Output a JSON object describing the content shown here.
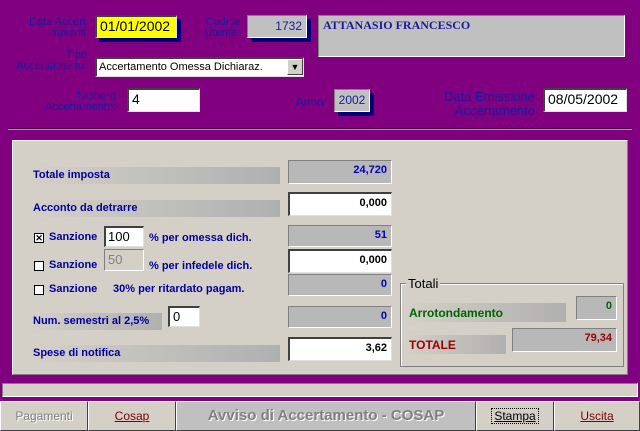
{
  "header": {
    "data_accert_label": "Data Accert impianti",
    "data_accert_value": "01/01/2002",
    "codice_utente_label": "Codice Utente:",
    "codice_utente_value": "1732",
    "nome_utente": "ATTANASIO FRANCESCO",
    "tipo_label": "Tipo Accertamento:",
    "tipo_value": "Accertamento Omessa Dichiaraz.",
    "numero_label": "Numero Accertamento:",
    "numero_value": "4",
    "anno_label": "Anno:",
    "anno_value": "2002",
    "data_emissione_label": "Data Emissione Accertamento",
    "data_emissione_value": "08/05/2002"
  },
  "form": {
    "totale_imposta_label": "Totale imposta",
    "totale_imposta_value": "24,720",
    "acconto_label": "Acconto da detrarre",
    "acconto_value": "0,000",
    "sanzione1_label": "Sanzione",
    "sanzione1_checked": true,
    "sanzione1_pct": "100",
    "sanzione1_desc": "% per omessa dich.",
    "sanzione1_value": "51",
    "sanzione2_label": "Sanzione",
    "sanzione2_checked": false,
    "sanzione2_pct": "50",
    "sanzione2_desc": "% per infedele dich.",
    "sanzione2_value": "0,000",
    "sanzione3_label": "Sanzione",
    "sanzione3_checked": false,
    "sanzione3_desc": "30% per ritardato pagam.",
    "sanzione3_value": "0",
    "semestri_label": "Num. semestri al 2,5%",
    "semestri_input": "0",
    "semestri_value": "0",
    "spese_label": "Spese di notifica",
    "spese_value": "3,62"
  },
  "totali": {
    "title": "Totali",
    "arrotondamento_label": "Arrotondamento",
    "arrotondamento_value": "0",
    "totale_label": "TOTALE",
    "totale_value": "79,34"
  },
  "footer": {
    "pagamenti": "Pagamenti",
    "cosap": "Cosap",
    "title": "Avviso di Accertamento - COSAP",
    "stampa": "Stampa",
    "uscita": "Uscita"
  },
  "colors": {
    "background": "#800080",
    "panel": "#d4d0c8",
    "label_blue": "#1a1aa0",
    "highlight_yellow": "#ffff00",
    "totale_red": "#a00000",
    "arrotondamento_green": "#006400"
  }
}
